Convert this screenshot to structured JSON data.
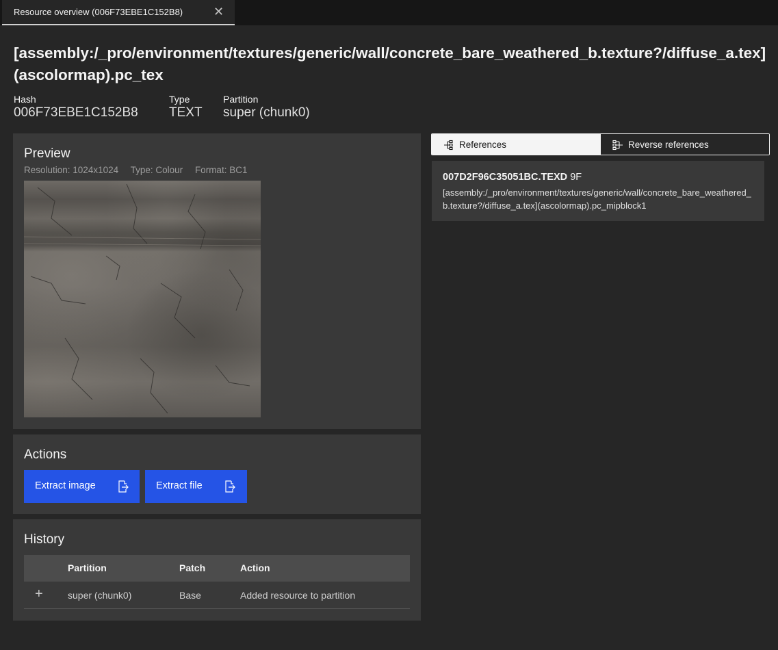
{
  "tab": {
    "label": "Resource overview (006F73EBE1C152B8)",
    "close_glyph": "✕"
  },
  "resource": {
    "title": "[assembly:/_pro/environment/textures/generic/wall/concrete_bare_weathered_b.texture?/diffuse_a.tex](ascolormap).pc_tex",
    "hash_label": "Hash",
    "hash_value": "006F73EBE1C152B8",
    "type_label": "Type",
    "type_value": "TEXT",
    "partition_label": "Partition",
    "partition_value": "super (chunk0)"
  },
  "preview": {
    "title": "Preview",
    "resolution": "Resolution: 1024x1024",
    "type": "Type: Colour",
    "format": "Format: BC1"
  },
  "actions": {
    "title": "Actions",
    "extract_image_label": "Extract image",
    "extract_file_label": "Extract file",
    "button_icon": "export-icon"
  },
  "history": {
    "title": "History",
    "columns": [
      "Partition",
      "Patch",
      "Action"
    ],
    "rows": [
      {
        "expand_glyph": "+",
        "partition": "super (chunk0)",
        "patch": "Base",
        "action": "Added resource to partition"
      }
    ]
  },
  "references": {
    "tabs": [
      {
        "label": "References",
        "icon": "tree-view-icon",
        "selected": true
      },
      {
        "label": "Reverse references",
        "icon": "reverse-tree-view-icon",
        "selected": false
      }
    ],
    "items": [
      {
        "hash": "007D2F96C35051BC.TEXD",
        "flag": "9F",
        "path": "[assembly:/_pro/environment/textures/generic/wall/concrete_bare_weathered_b.texture?/diffuse_a.tex](ascolormap).pc_mipblock1"
      }
    ]
  },
  "colors": {
    "background": "#262626",
    "panel": "#393939",
    "primary_button": "#2554e6",
    "table_header": "#4c4c4c"
  }
}
